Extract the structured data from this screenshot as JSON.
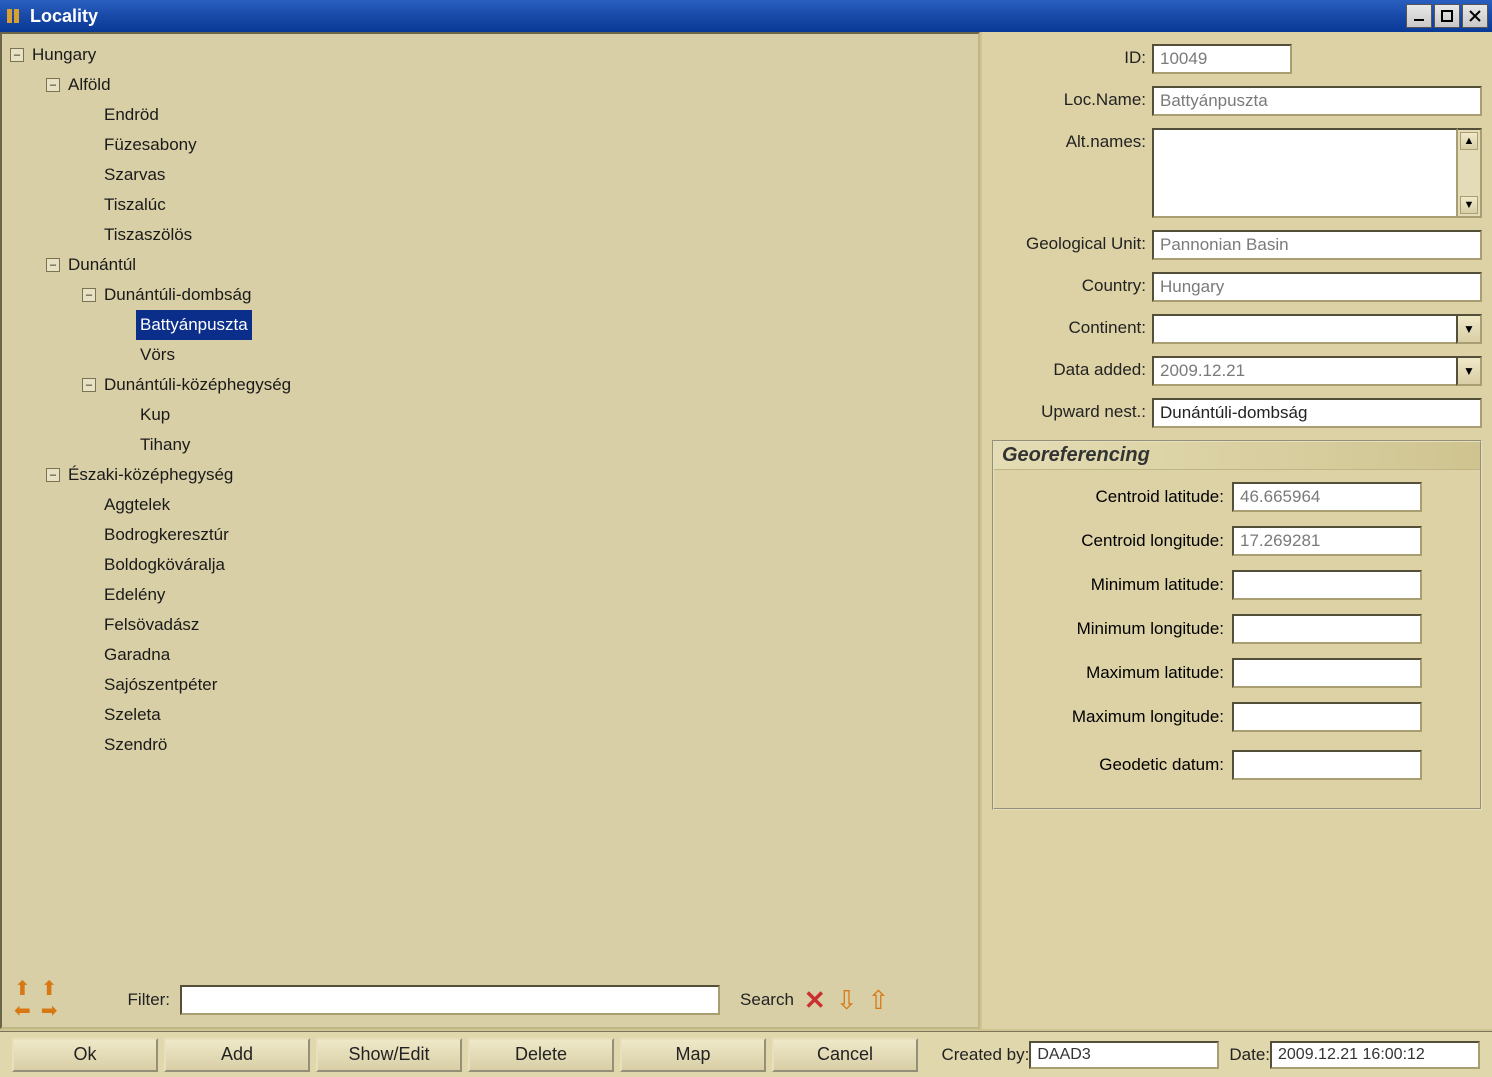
{
  "window": {
    "title": "Locality"
  },
  "tree": {
    "root": {
      "label": "Hungary",
      "expanded": true,
      "children": [
        {
          "label": "Alföld",
          "expanded": true,
          "children": [
            {
              "label": "Endröd"
            },
            {
              "label": "Füzesabony"
            },
            {
              "label": "Szarvas"
            },
            {
              "label": "Tiszalúc"
            },
            {
              "label": "Tiszaszölös"
            }
          ]
        },
        {
          "label": "Dunántúl",
          "expanded": true,
          "children": [
            {
              "label": "Dunántúli-dombság",
              "expanded": true,
              "children": [
                {
                  "label": "Battyánpuszta",
                  "selected": true
                },
                {
                  "label": "Vörs"
                }
              ]
            },
            {
              "label": "Dunántúli-középhegység",
              "expanded": true,
              "children": [
                {
                  "label": "Kup"
                },
                {
                  "label": "Tihany"
                }
              ]
            }
          ]
        },
        {
          "label": "Északi-középhegység",
          "expanded": true,
          "children": [
            {
              "label": "Aggtelek"
            },
            {
              "label": "Bodrogkeresztúr"
            },
            {
              "label": "Boldogköváralja"
            },
            {
              "label": "Edelény"
            },
            {
              "label": "Felsövadász"
            },
            {
              "label": "Garadna"
            },
            {
              "label": "Sajószentpéter"
            },
            {
              "label": "Szeleta"
            },
            {
              "label": "Szendrö"
            }
          ]
        }
      ]
    }
  },
  "filter": {
    "label": "Filter:",
    "value": "",
    "search_label": "Search"
  },
  "form": {
    "id": {
      "label": "ID:",
      "value": "10049"
    },
    "locname": {
      "label": "Loc.Name:",
      "value": "Battyánpuszta"
    },
    "altnames": {
      "label": "Alt.names:",
      "value": ""
    },
    "geounit": {
      "label": "Geological Unit:",
      "value": "Pannonian Basin"
    },
    "country": {
      "label": "Country:",
      "value": "Hungary"
    },
    "continent": {
      "label": "Continent:",
      "value": ""
    },
    "dataadded": {
      "label": "Data added:",
      "value": "2009.12.21"
    },
    "upward": {
      "label": "Upward nest.:",
      "value": "Dunántúli-dombság"
    }
  },
  "geo": {
    "title": "Georeferencing",
    "clat": {
      "label": "Centroid latitude:",
      "value": "46.665964"
    },
    "clon": {
      "label": "Centroid longitude:",
      "value": "17.269281"
    },
    "minlat": {
      "label": "Minimum latitude:",
      "value": ""
    },
    "minlon": {
      "label": "Minimum longitude:",
      "value": ""
    },
    "maxlat": {
      "label": "Maximum latitude:",
      "value": ""
    },
    "maxlon": {
      "label": "Maximum longitude:",
      "value": ""
    },
    "datum": {
      "label": "Geodetic datum:",
      "value": ""
    }
  },
  "buttons": {
    "ok": "Ok",
    "add": "Add",
    "showedit": "Show/Edit",
    "delete": "Delete",
    "map": "Map",
    "cancel": "Cancel"
  },
  "meta": {
    "createdby_label": "Created by:",
    "createdby": "DAAD3",
    "date_label": "Date:",
    "date": "2009.12.21 16:00:12"
  }
}
